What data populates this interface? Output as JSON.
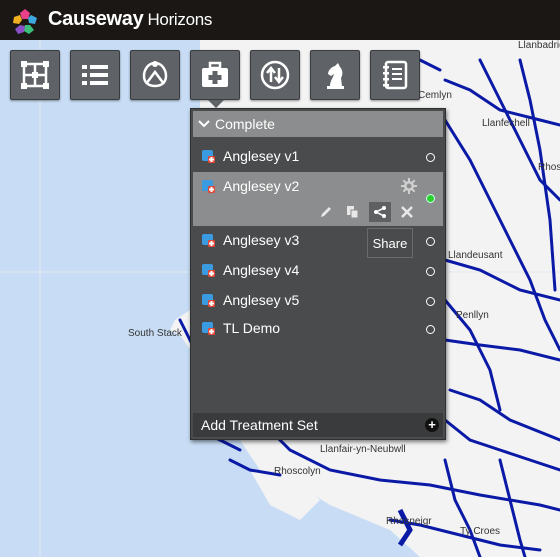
{
  "app": {
    "brand": "Causeway",
    "product": "Horizons"
  },
  "toolbar": {
    "buttons": [
      {
        "name": "network-button",
        "icon": "network-grid-icon"
      },
      {
        "name": "list-button",
        "icon": "list-icon"
      },
      {
        "name": "segments-button",
        "icon": "road-segment-icon"
      },
      {
        "name": "treatments-button",
        "icon": "medical-kit-icon",
        "active": true
      },
      {
        "name": "budget-button",
        "icon": "up-down-arrows-icon"
      },
      {
        "name": "strategy-button",
        "icon": "chess-knight-icon"
      },
      {
        "name": "reports-button",
        "icon": "notebook-icon"
      }
    ]
  },
  "panel": {
    "group": "Complete",
    "items": [
      {
        "label": "Anglesey v1",
        "selected": false
      },
      {
        "label": "Anglesey v2",
        "selected": true
      },
      {
        "label": "Anglesey v3",
        "selected": false
      },
      {
        "label": "Anglesey v4",
        "selected": false
      },
      {
        "label": "Anglesey v5",
        "selected": false
      },
      {
        "label": "TL Demo",
        "selected": false
      }
    ],
    "tooltip": "Share",
    "footer": "Add Treatment Set"
  },
  "map": {
    "labels": [
      {
        "text": "South Stack"
      },
      {
        "text": "Rhosneigr"
      },
      {
        "text": "Rhoscolyn"
      },
      {
        "text": "Llanfair-yn-Neubwll"
      },
      {
        "text": "Llanbadrig"
      },
      {
        "text": "Cemlyn"
      },
      {
        "text": "Llanfechell"
      },
      {
        "text": "Llandeusant"
      },
      {
        "text": "Penllyn"
      },
      {
        "text": "Rhosgoch"
      },
      {
        "text": "Ty Croes"
      }
    ]
  },
  "colors": {
    "road": "#0b1aa6",
    "sea": "#c8ddf5",
    "land": "#f2f2f2",
    "accent": "#2ad12a"
  }
}
